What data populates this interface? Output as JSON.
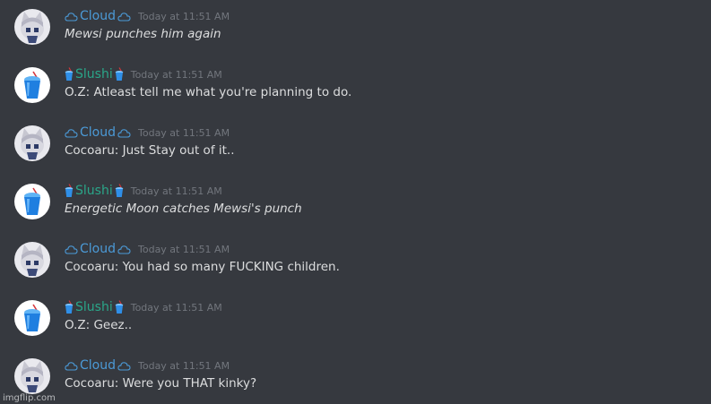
{
  "colors": {
    "background": "#36393f",
    "cloud_name": "#4b9ad7",
    "slushi_name": "#2aa689",
    "timestamp": "#72767d",
    "message_text": "#dcddde"
  },
  "users": {
    "cloud": {
      "name": "Cloud",
      "decoration_icon": "cloud-outline-icon",
      "avatar_icon": "anime-catgirl-avatar"
    },
    "slushi": {
      "name": "Slushi",
      "decoration_icon": "slushie-cup-icon",
      "avatar_icon": "blue-slushie-avatar"
    }
  },
  "messages": [
    {
      "author": "Cloud",
      "timestamp": "Today at 11:51 AM",
      "text": "Mewsi punches him again",
      "style": "italic"
    },
    {
      "author": "Slushi",
      "timestamp": "Today at 11:51 AM",
      "text": "O.Z: Atleast tell me what you're planning to do.",
      "style": "normal"
    },
    {
      "author": "Cloud",
      "timestamp": "Today at 11:51 AM",
      "text": "Cocoaru: Just Stay out of it..",
      "style": "normal"
    },
    {
      "author": "Slushi",
      "timestamp": "Today at 11:51 AM",
      "text": "Energetic Moon catches Mewsi's punch",
      "style": "italic"
    },
    {
      "author": "Cloud",
      "timestamp": "Today at 11:51 AM",
      "text": "Cocoaru: You had so many FUCKING children.",
      "style": "normal"
    },
    {
      "author": "Slushi",
      "timestamp": "Today at 11:51 AM",
      "text": "O.Z: Geez..",
      "style": "normal"
    },
    {
      "author": "Cloud",
      "timestamp": "Today at 11:51 AM",
      "text": "Cocoaru: Were you THAT kinky?",
      "style": "normal"
    }
  ],
  "watermark": "imgflip.com"
}
